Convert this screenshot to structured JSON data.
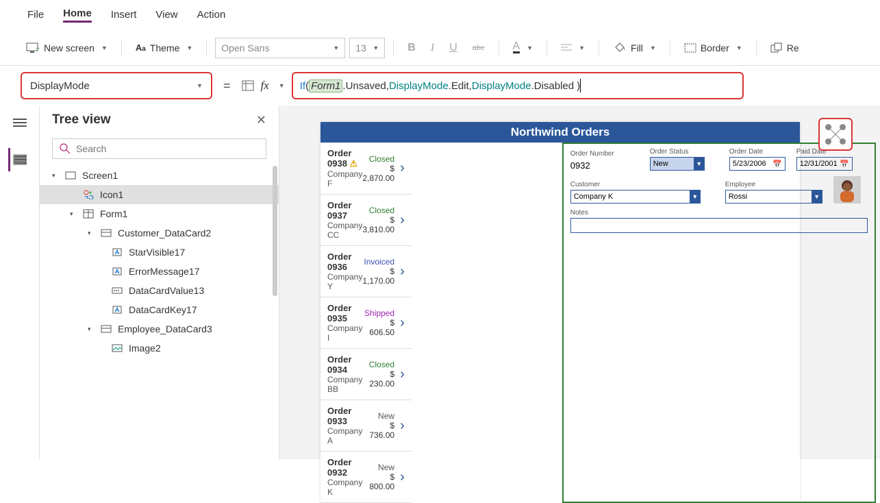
{
  "menu": {
    "file": "File",
    "home": "Home",
    "insert": "Insert",
    "view": "View",
    "action": "Action"
  },
  "ribbon": {
    "new_screen": "New screen",
    "theme": "Theme",
    "font": "Open Sans",
    "size": "13",
    "fill": "Fill",
    "border": "Border",
    "reorder": "Re"
  },
  "property_selector": "DisplayMode",
  "formula": {
    "if": "If",
    "lparen": "( ",
    "form_ref": "Form1",
    "unsaved": ".Unsaved, ",
    "dm1": "DisplayMode",
    "edit": ".Edit, ",
    "dm2": "DisplayMode",
    "disabled": ".Disabled )"
  },
  "tree": {
    "title": "Tree view",
    "search_placeholder": "Search",
    "nodes": {
      "screen1": "Screen1",
      "icon1": "Icon1",
      "form1": "Form1",
      "customer_card": "Customer_DataCard2",
      "star": "StarVisible17",
      "error": "ErrorMessage17",
      "dcv": "DataCardValue13",
      "dck": "DataCardKey17",
      "employee_card": "Employee_DataCard3",
      "image2": "Image2"
    }
  },
  "app": {
    "title": "Northwind Orders",
    "orders": [
      {
        "num": "Order 0938",
        "warn": true,
        "co": "Company F",
        "status": "Closed",
        "status_cls": "status-closed",
        "amt": "$ 2,870.00"
      },
      {
        "num": "Order 0937",
        "co": "Company CC",
        "status": "Closed",
        "status_cls": "status-closed",
        "amt": "$ 3,810.00"
      },
      {
        "num": "Order 0936",
        "co": "Company Y",
        "status": "Invoiced",
        "status_cls": "status-invoiced",
        "amt": "$ 1,170.00"
      },
      {
        "num": "Order 0935",
        "co": "Company I",
        "status": "Shipped",
        "status_cls": "status-shipped",
        "amt": "$ 606.50"
      },
      {
        "num": "Order 0934",
        "co": "Company BB",
        "status": "Closed",
        "status_cls": "status-closed",
        "amt": "$ 230.00"
      },
      {
        "num": "Order 0933",
        "co": "Company A",
        "status": "New",
        "status_cls": "status-new",
        "amt": "$ 736.00"
      },
      {
        "num": "Order 0932",
        "co": "Company K",
        "status": "New",
        "status_cls": "status-new",
        "amt": "$ 800.00"
      }
    ],
    "form": {
      "order_number_label": "Order Number",
      "order_number": "0932",
      "order_status_label": "Order Status",
      "order_status": "New",
      "order_date_label": "Order Date",
      "order_date": "5/23/2006",
      "paid_date_label": "Paid Date",
      "paid_date": "12/31/2001",
      "customer_label": "Customer",
      "customer": "Company K",
      "employee_label": "Employee",
      "employee": "Rossi",
      "notes_label": "Notes"
    }
  }
}
